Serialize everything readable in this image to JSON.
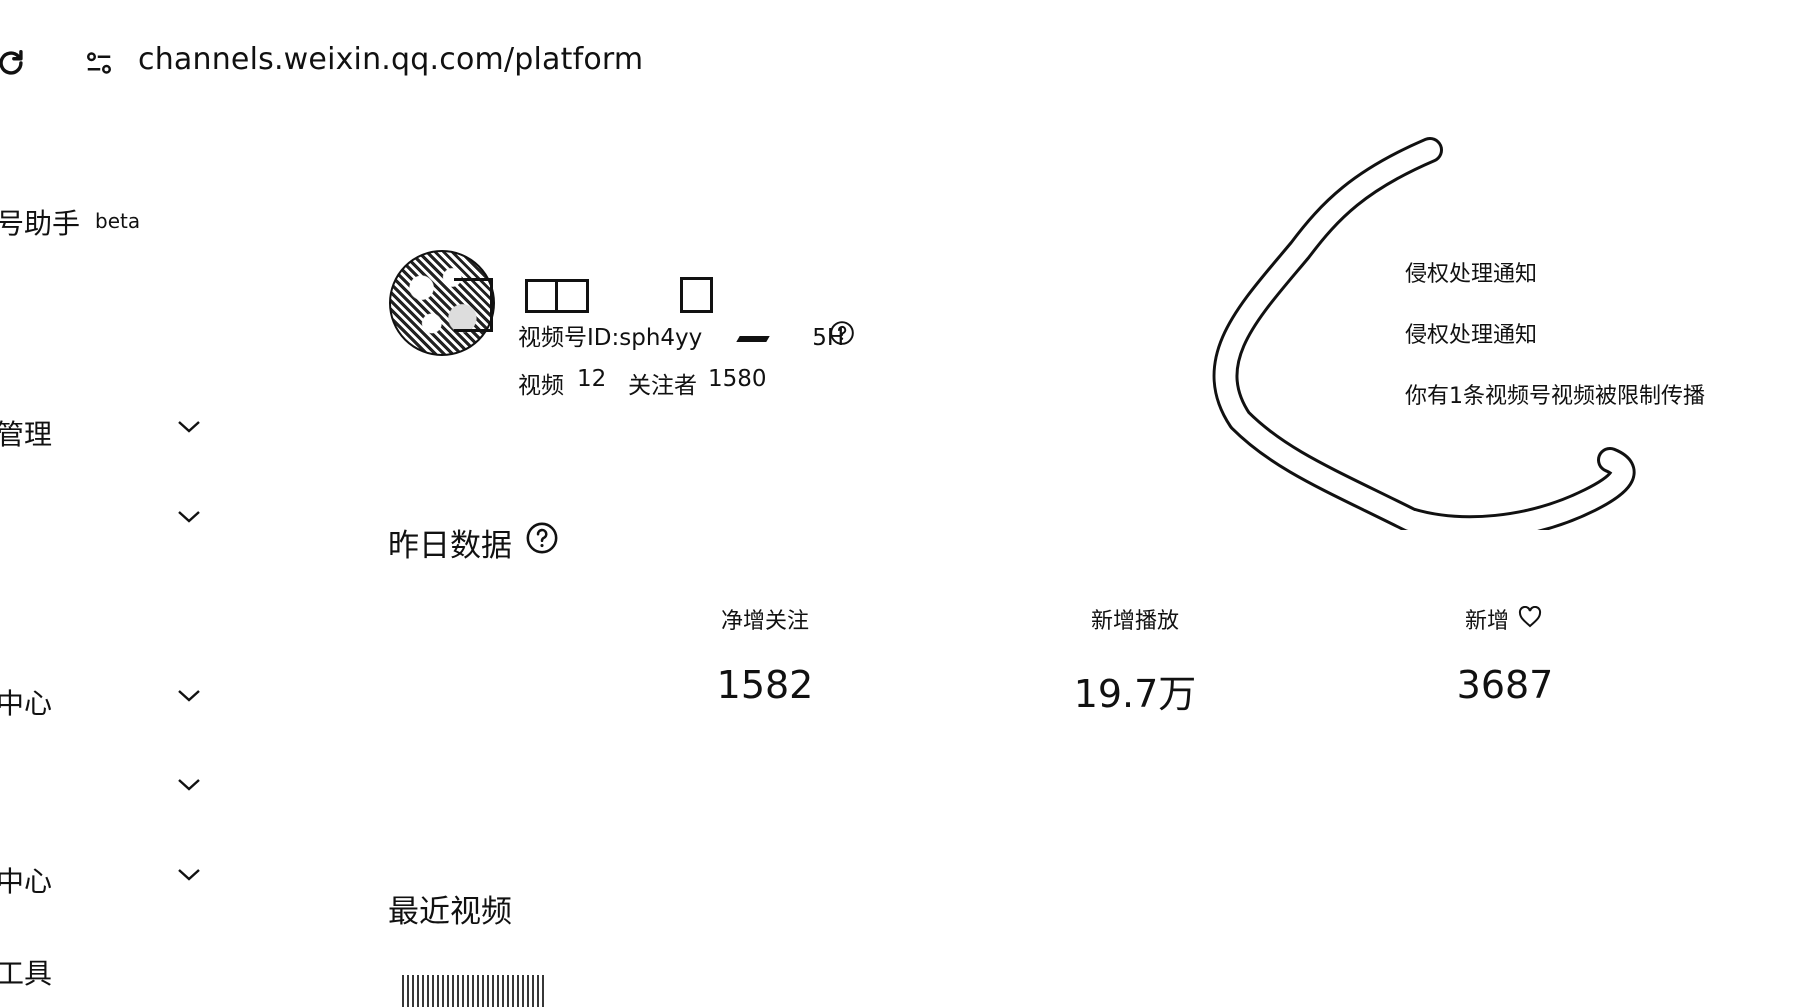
{
  "browser": {
    "url": "channels.weixin.qq.com/platform",
    "icons": [
      "refresh-icon",
      "tune-icon"
    ]
  },
  "sidebar": {
    "brand": "号助手",
    "beta": "beta",
    "items": [
      {
        "label": "管理"
      },
      {
        "label": ""
      },
      {
        "label": "中心"
      },
      {
        "label": ""
      },
      {
        "label": "中心"
      },
      {
        "label": "工具"
      }
    ]
  },
  "profile": {
    "channel_id": "视频号ID:sph4yy",
    "channel_id_suffix": "5H",
    "video_label": "视频",
    "video_count": "12",
    "follower_label": "关注者",
    "follower_count": "1580"
  },
  "notifications": [
    {
      "text": "侵权处理通知"
    },
    {
      "text": "侵权处理通知"
    },
    {
      "text": "你有1条视频号视频被限制传播"
    }
  ],
  "yesterday": {
    "title": "昨日数据",
    "stats": [
      {
        "label": "净增关注",
        "value": "1582"
      },
      {
        "label": "新增播放",
        "value": "19.7万"
      },
      {
        "label": "新增",
        "value": "3687"
      }
    ]
  },
  "recent": {
    "title": "最近视频"
  }
}
